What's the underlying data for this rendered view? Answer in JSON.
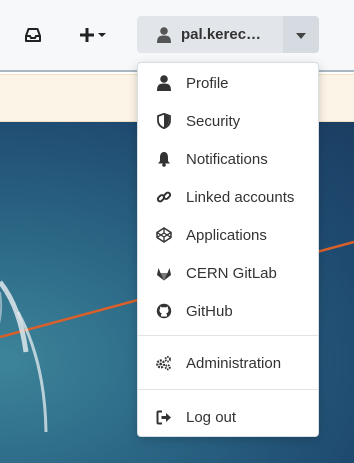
{
  "navbar": {
    "inbox_icon": "inbox-icon",
    "plus_icon": "plus-icon",
    "user": {
      "name": "pal.kerec…",
      "icon": "user-icon"
    },
    "caret_icon": "caret-down-icon"
  },
  "menu": {
    "items": [
      {
        "label": "Profile",
        "icon": "user-icon"
      },
      {
        "label": "Security",
        "icon": "shield-icon"
      },
      {
        "label": "Notifications",
        "icon": "bell-icon"
      },
      {
        "label": "Linked accounts",
        "icon": "link-icon"
      },
      {
        "label": "Applications",
        "icon": "codepen-icon"
      },
      {
        "label": "CERN GitLab",
        "icon": "gitlab-icon"
      },
      {
        "label": "GitHub",
        "icon": "github-icon"
      }
    ],
    "admin": {
      "label": "Administration",
      "icon": "cogs-icon"
    },
    "logout": {
      "label": "Log out",
      "icon": "sign-out-icon"
    }
  },
  "colors": {
    "navbar_bg": "#f7f8f9",
    "notice_bg": "#fdf4e8",
    "hero_dark": "#1b3e62",
    "accent_line": "#d9602a"
  }
}
